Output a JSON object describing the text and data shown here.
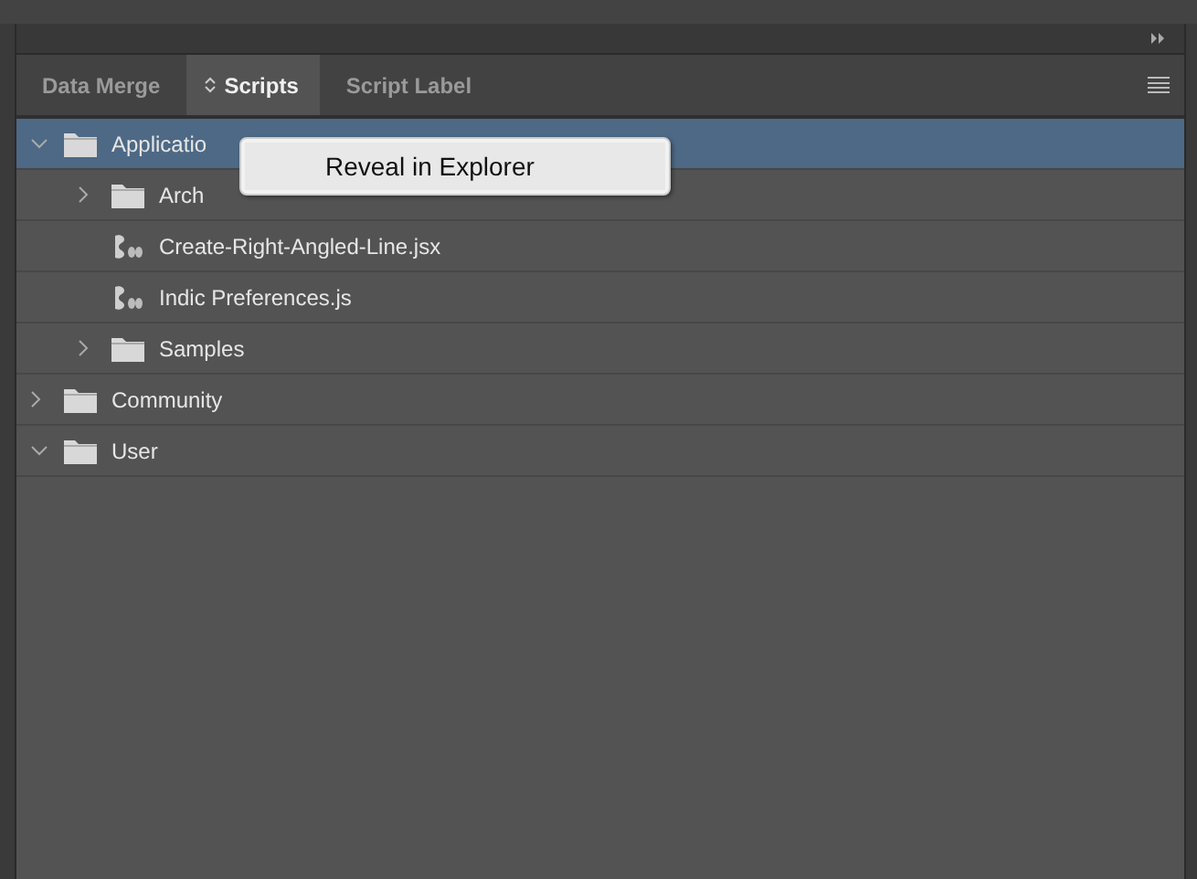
{
  "tabs": [
    {
      "label": "Data Merge",
      "selected": false
    },
    {
      "label": "Scripts",
      "selected": true
    },
    {
      "label": "Script Label",
      "selected": false
    }
  ],
  "tree": [
    {
      "kind": "folder",
      "label": "Applicatio",
      "expanded": true,
      "selected": true,
      "children": [
        {
          "kind": "folder",
          "label": "Arch",
          "expanded": false,
          "selected": false
        },
        {
          "kind": "script",
          "label": "Create-Right-Angled-Line.jsx",
          "selected": false
        },
        {
          "kind": "script",
          "label": "Indic Preferences.js",
          "selected": false
        },
        {
          "kind": "folder",
          "label": "Samples",
          "expanded": false,
          "selected": false
        }
      ]
    },
    {
      "kind": "folder",
      "label": "Community",
      "expanded": false,
      "selected": false
    },
    {
      "kind": "folder",
      "label": "User",
      "expanded": true,
      "selected": false
    }
  ],
  "context_menu": {
    "items": [
      "Reveal in Explorer"
    ]
  }
}
